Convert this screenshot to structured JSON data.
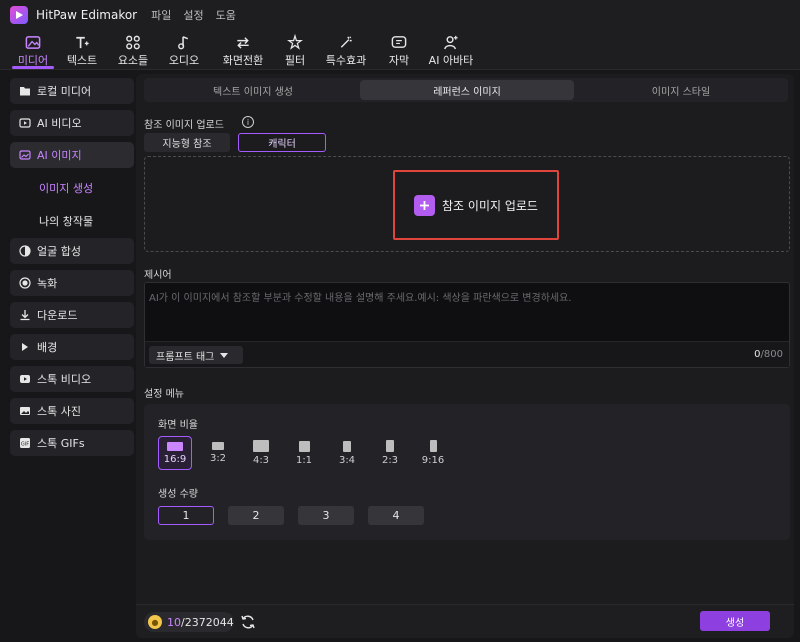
{
  "app": {
    "title": "HitPaw Edimakor"
  },
  "menu": [
    "파일",
    "설정",
    "도움"
  ],
  "toolbar": {
    "items": [
      {
        "label": "미디어",
        "icon": "media-icon",
        "active": true
      },
      {
        "label": "텍스트",
        "icon": "text-icon"
      },
      {
        "label": "요소들",
        "icon": "elements-icon"
      },
      {
        "label": "오디오",
        "icon": "audio-icon"
      },
      {
        "label": "화면전환",
        "icon": "transition-icon"
      },
      {
        "label": "필터",
        "icon": "filter-icon"
      },
      {
        "label": "특수효과",
        "icon": "effects-icon"
      },
      {
        "label": "자막",
        "icon": "subtitle-icon"
      },
      {
        "label": "AI 아바타",
        "icon": "avatar-icon"
      }
    ],
    "accent": "#a55cff"
  },
  "sidebar": {
    "items": [
      {
        "label": "로컬 미디어",
        "icon": "folder-icon"
      },
      {
        "label": "AI 비디오",
        "icon": "ai-video-icon"
      },
      {
        "label": "AI 이미지",
        "icon": "ai-image-icon",
        "active": true
      },
      {
        "label": "얼굴 합성",
        "icon": "face-swap-icon"
      },
      {
        "label": "녹화",
        "icon": "record-icon"
      },
      {
        "label": "다운로드",
        "icon": "download-icon"
      },
      {
        "label": "배경",
        "icon": "play-icon"
      },
      {
        "label": "스톡 비디오",
        "icon": "stock-video-icon"
      },
      {
        "label": "스톡 사진",
        "icon": "stock-photo-icon"
      },
      {
        "label": "스톡 GIFs",
        "icon": "gif-icon"
      }
    ],
    "sub_items": [
      {
        "label": "이미지 생성",
        "active": true
      },
      {
        "label": "나의 창작물"
      }
    ]
  },
  "main": {
    "tabs": [
      {
        "label": "텍스트 이미지 생성"
      },
      {
        "label": "레퍼런스 이미지",
        "active": true
      },
      {
        "label": "이미지 스타일"
      }
    ],
    "ref_upload": {
      "label": "참조 이미지 업로드",
      "info": "i",
      "modes": [
        {
          "label": "지능형 참조"
        },
        {
          "label": "캐릭터",
          "active": true
        }
      ],
      "button_label": "참조 이미지 업로드"
    },
    "prompt": {
      "label": "제시어",
      "placeholder": "AI가 이 이미지에서 참조할 부분과 수정할 내용을 설명해 주세요.예시: 색상을 파란색으로 변경하세요.",
      "tag_button": "프롬프트 태그",
      "count_current": "0",
      "count_max": "/800"
    },
    "settings": {
      "label": "설정 메뉴",
      "ratio_label": "화면 비율",
      "ratios": [
        "16:9",
        "3:2",
        "4:3",
        "1:1",
        "3:4",
        "2:3",
        "9:16"
      ],
      "selected_ratio": "16:9",
      "count_label": "생성 수량",
      "counts": [
        "1",
        "2",
        "3",
        "4"
      ],
      "selected_count": "1"
    },
    "footer": {
      "credits_used": "10",
      "credits_total": "/2372044",
      "generate_label": "생성"
    }
  }
}
